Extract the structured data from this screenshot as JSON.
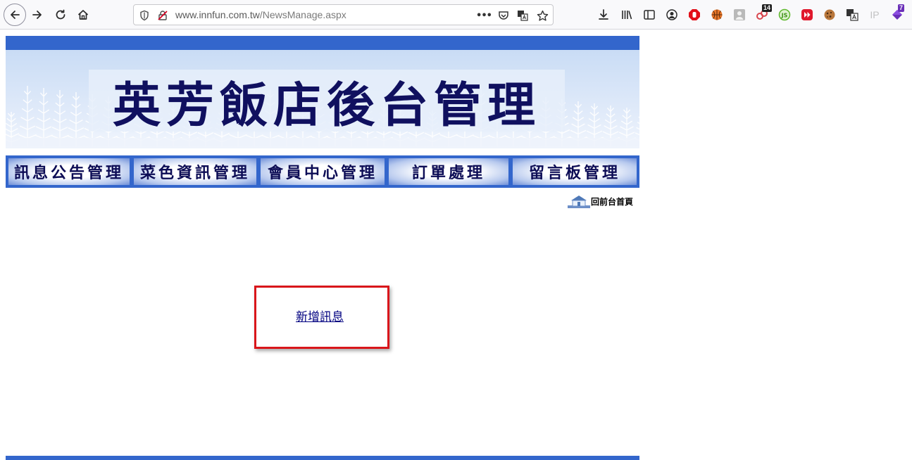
{
  "browser": {
    "url_host": "www.innfun.com.tw",
    "url_path": "/NewsManage.aspx",
    "overflow_menu": "•••",
    "extensions_badge_count": "14",
    "extension_ip_label": "IP",
    "extension_last_badge": "7"
  },
  "page": {
    "banner_title": "英芳飯店後台管理",
    "menu": [
      {
        "label": "訊息公告管理"
      },
      {
        "label": "菜色資訊管理"
      },
      {
        "label": "會員中心管理"
      },
      {
        "label": "訂單處理"
      },
      {
        "label": "留言板管理"
      }
    ],
    "home_link_label": "回前台首頁",
    "add_news_link": "新增訊息"
  },
  "colors": {
    "nav_blue": "#3366cc",
    "title_navy": "#10105f",
    "highlight_red": "#d9161b",
    "link_navy": "#000080"
  }
}
